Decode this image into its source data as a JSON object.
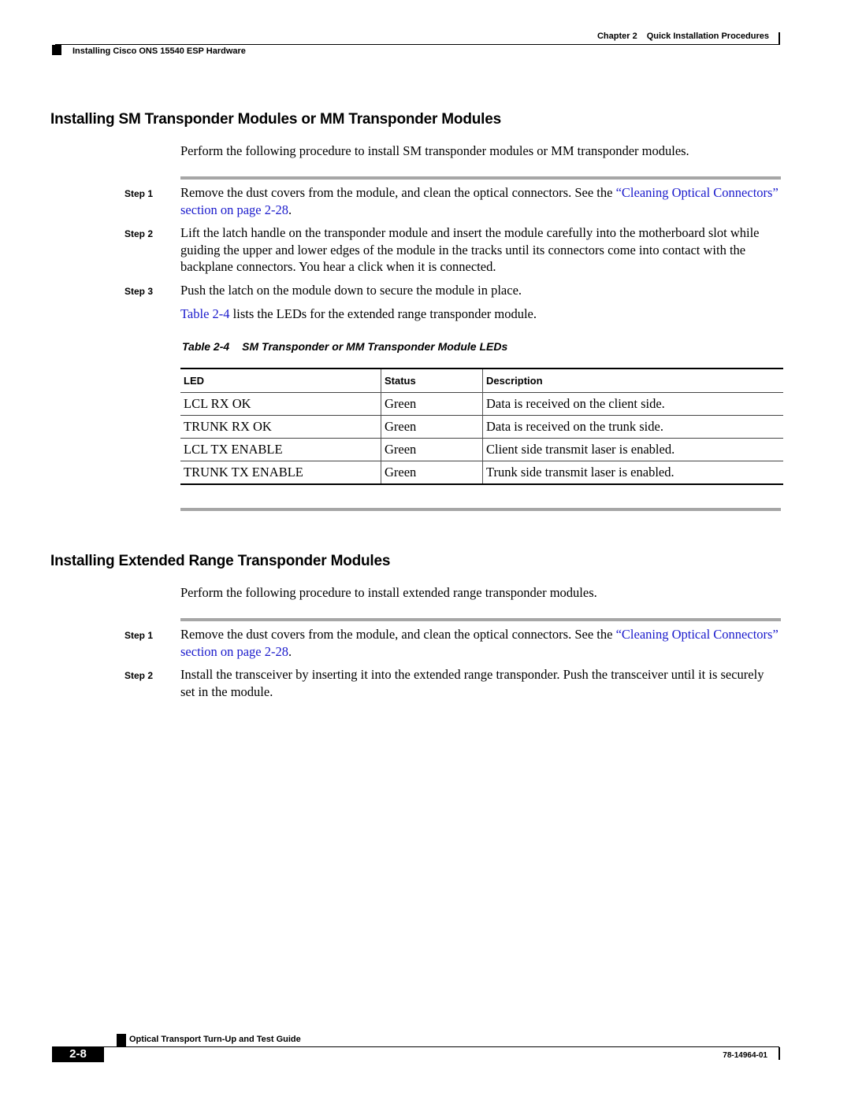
{
  "header": {
    "chapter_label": "Chapter 2",
    "chapter_title": "Quick Installation Procedures",
    "section_title": "Installing Cisco ONS 15540 ESP Hardware"
  },
  "section1": {
    "heading": "Installing SM Transponder Modules or MM Transponder Modules",
    "intro": "Perform the following procedure to install SM transponder modules or MM transponder modules.",
    "steps": [
      {
        "label": "Step 1",
        "text_before": "Remove the dust covers from the module, and clean the optical connectors. See the ",
        "link": "“Cleaning Optical Connectors” section on page 2-28",
        "text_after": "."
      },
      {
        "label": "Step 2",
        "text": "Lift the latch handle on the transponder module and insert the module carefully into the motherboard slot while guiding the upper and lower edges of the module in the tracks until its connectors come into contact with the backplane connectors. You hear a click when it is connected."
      },
      {
        "label": "Step 3",
        "text": "Push the latch on the module down to secure the module in place."
      }
    ],
    "table_ref_link": "Table 2-4",
    "table_ref_text": " lists the LEDs for the extended range transponder module."
  },
  "table": {
    "number": "Table 2-4",
    "title": "SM Transponder or MM Transponder Module LEDs",
    "columns": [
      "LED",
      "Status",
      "Description"
    ],
    "rows": [
      [
        "LCL RX OK",
        "Green",
        "Data is received on the client side."
      ],
      [
        "TRUNK RX OK",
        "Green",
        "Data is received on the trunk side."
      ],
      [
        "LCL TX ENABLE",
        "Green",
        "Client side transmit laser is enabled."
      ],
      [
        "TRUNK TX ENABLE",
        "Green",
        "Trunk side transmit laser is enabled."
      ]
    ]
  },
  "section2": {
    "heading": "Installing Extended Range Transponder Modules",
    "intro": "Perform the following procedure to install extended range transponder modules.",
    "steps": [
      {
        "label": "Step 1",
        "text_before": "Remove the dust covers from the module, and clean the optical connectors. See the ",
        "link": "“Cleaning Optical Connectors” section on page 2-28",
        "text_after": "."
      },
      {
        "label": "Step 2",
        "text": "Install the transceiver by inserting it into the extended range transponder. Push the transceiver until it is securely set in the module."
      }
    ]
  },
  "footer": {
    "guide_title": "Optical Transport Turn-Up and Test Guide",
    "page_number": "2-8",
    "doc_number": "78-14964-01"
  },
  "colors": {
    "link": "#1a1acc",
    "separator": "#a6a6a6"
  }
}
